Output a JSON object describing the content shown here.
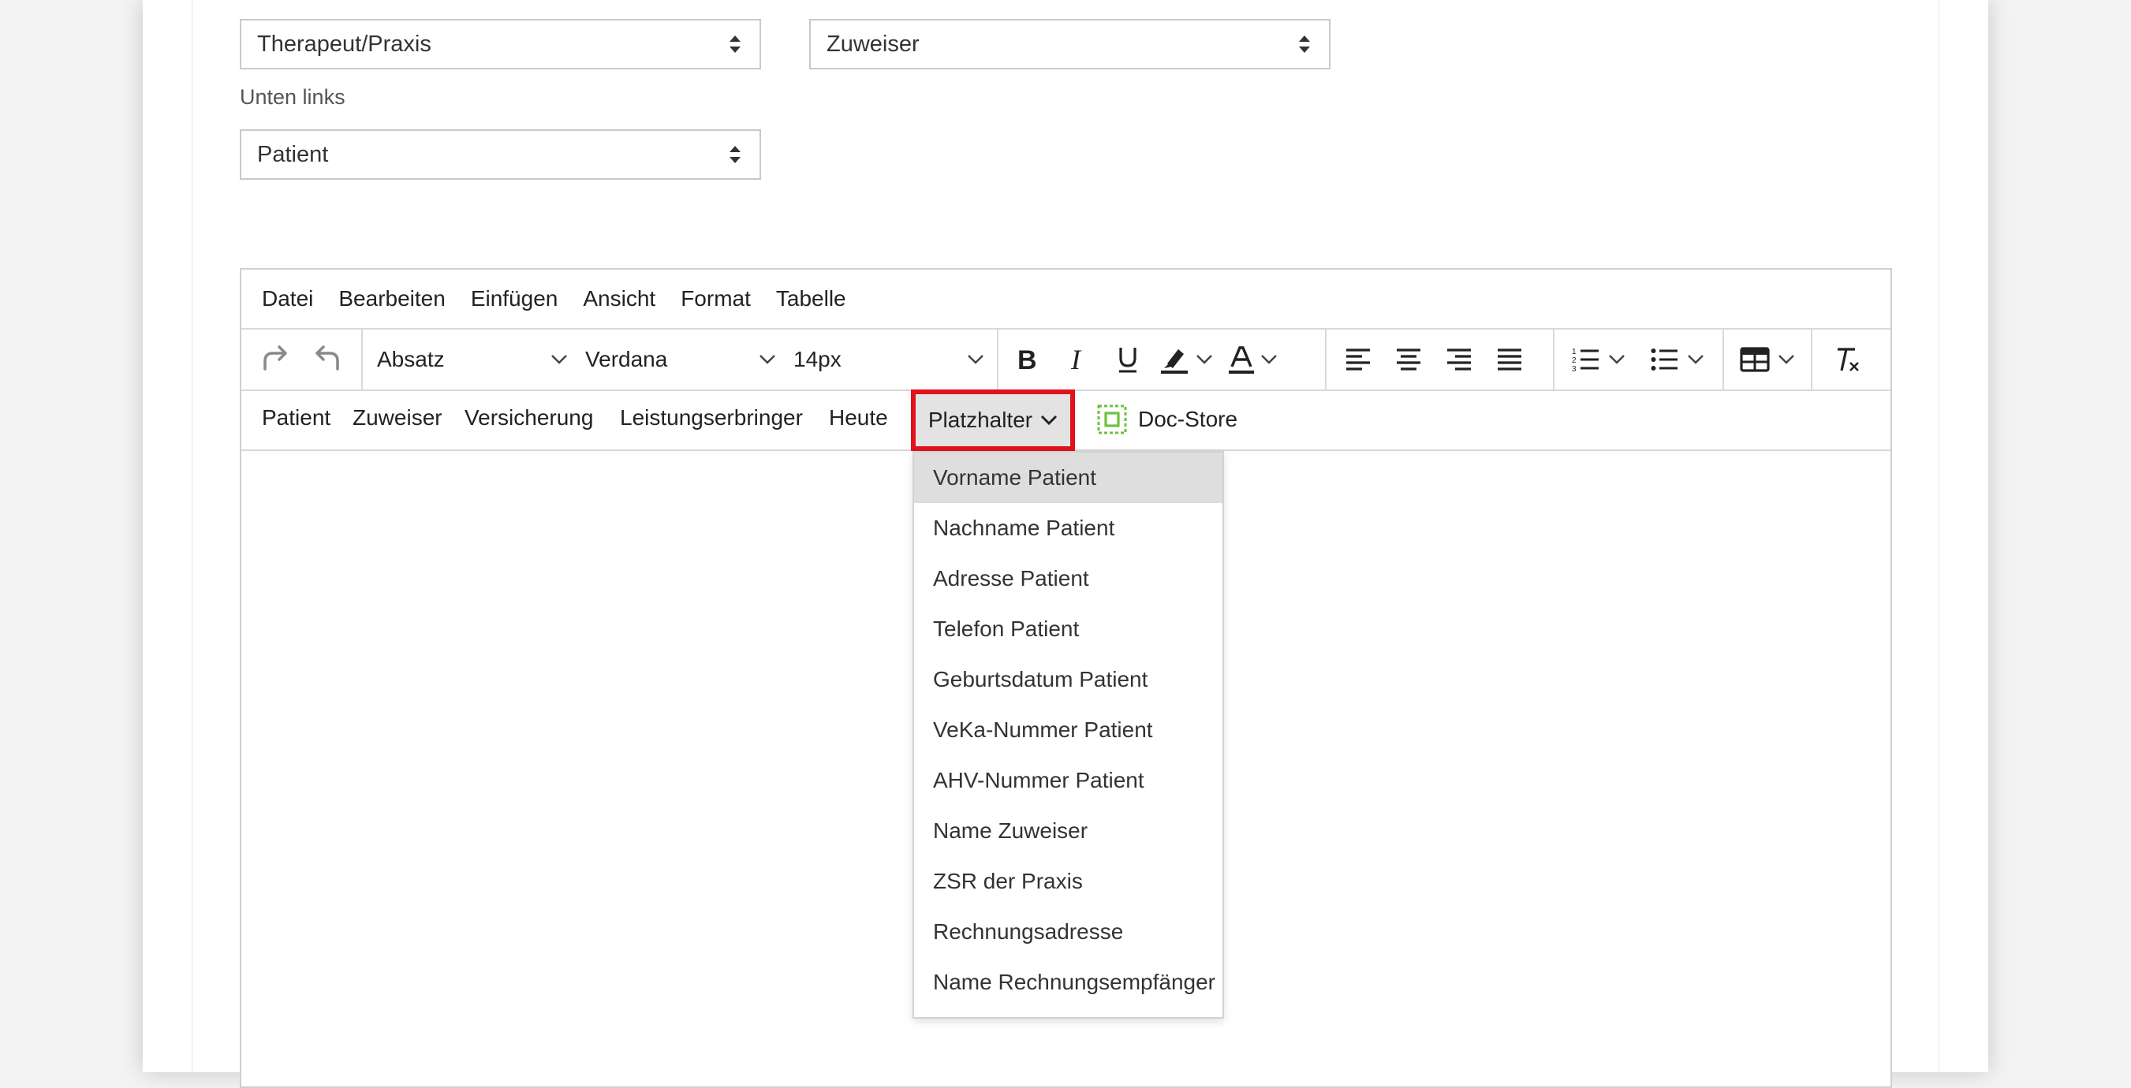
{
  "form": {
    "select_left": "Therapeut/Praxis",
    "select_right": "Zuweiser",
    "label_bottom_left": "Unten links",
    "select_bottom": "Patient"
  },
  "editor": {
    "menubar": [
      "Datei",
      "Bearbeiten",
      "Einfügen",
      "Ansicht",
      "Format",
      "Tabelle"
    ],
    "toolbar": {
      "block_format": "Absatz",
      "font_family": "Verdana",
      "font_size": "14px",
      "icons": [
        "redo-icon",
        "undo-icon",
        "bold-icon",
        "italic-icon",
        "underline-icon",
        "highlight-icon",
        "text-color-icon",
        "align-left-icon",
        "align-center-icon",
        "align-right-icon",
        "align-justify-icon",
        "numbered-list-icon",
        "bullet-list-icon",
        "table-icon",
        "clear-format-icon"
      ]
    },
    "custombar": {
      "items": [
        "Patient",
        "Zuweiser",
        "Versicherung",
        "Leistungserbringer",
        "Heute"
      ],
      "placeholder_label": "Platzhalter",
      "docstore_label": "Doc-Store"
    },
    "placeholder_menu": [
      "Vorname Patient",
      "Nachname Patient",
      "Adresse Patient",
      "Telefon Patient",
      "Geburtsdatum Patient",
      "VeKa-Nummer Patient",
      "AHV-Nummer Patient",
      "Name Zuweiser",
      "ZSR der Praxis",
      "Rechnungsadresse",
      "Name Rechnungsempfänger"
    ],
    "colors": {
      "highlight_border": "#e0121b",
      "docstore_icon": "#6cc13a"
    }
  }
}
